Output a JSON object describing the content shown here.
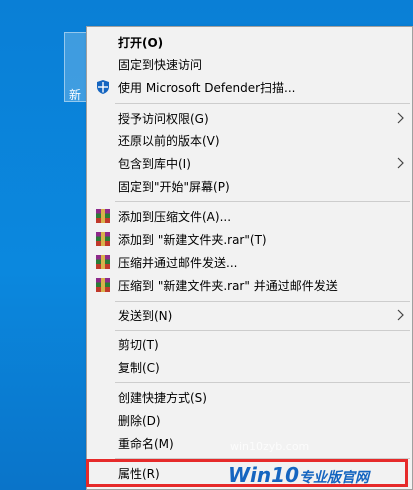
{
  "desktop": {
    "folder_label": "新"
  },
  "context_menu": {
    "open": "打开(O)",
    "pin_quick_access": "固定到快速访问",
    "defender_scan": "使用 Microsoft Defender扫描...",
    "grant_access": "授予访问权限(G)",
    "restore_versions": "还原以前的版本(V)",
    "include_library": "包含到库中(I)",
    "pin_start": "固定到\"开始\"屏幕(P)",
    "add_archive": "添加到压缩文件(A)...",
    "add_rar": "添加到 \"新建文件夹.rar\"(T)",
    "compress_email": "压缩并通过邮件发送...",
    "compress_rar_email": "压缩到 \"新建文件夹.rar\" 并通过邮件发送",
    "send_to": "发送到(N)",
    "cut": "剪切(T)",
    "copy": "复制(C)",
    "create_shortcut": "创建快捷方式(S)",
    "delete": "删除(D)",
    "rename": "重命名(M)",
    "properties": "属性(R)"
  },
  "watermark": {
    "url": "win10zyb.com",
    "logo_win": "Win10",
    "logo_rest": "专业版官网"
  },
  "colors": {
    "desktop": "#0a7fd6",
    "menu_bg": "#f2f2f2",
    "highlight": "#e62a2a",
    "defender": "#1565c0"
  }
}
